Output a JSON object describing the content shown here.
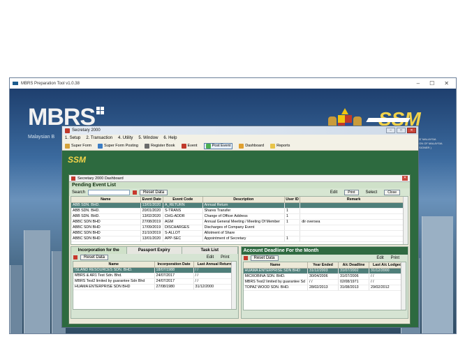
{
  "outer": {
    "title": "MBRS Preparation Tool v1.0.38",
    "logo_main": "MBRS",
    "logo_sub": "Malaysian B",
    "ssm_logo": "SSM",
    "ssm_sub_1": "AT MALAYSIA",
    "ssm_sub_2": "ION OF MALAYSIA",
    "ssm_sub_3": "ISIONER )"
  },
  "secretary": {
    "title": "Secretary 2000",
    "menu": [
      "1. Setup",
      "2. Transaction",
      "4. Utility",
      "5. Window",
      "6. Help"
    ],
    "toolbar": [
      "Super Form",
      "Super Form Posting",
      "Register Book",
      "Event",
      "Post Event",
      "Dashboard",
      "Reports"
    ],
    "badge_text": "SSM"
  },
  "dashboard": {
    "title": "Secretary 2000 Dashboard",
    "pending_title": "Pending Event List",
    "search_label": "Search",
    "search_value": "",
    "reset_label": "Reset Data",
    "edit_label": "Edit",
    "print_label": "Print",
    "select_label": "Select",
    "close_label": "Close",
    "pending_headers": [
      "Name",
      "Event Date",
      "Event Code",
      "Description",
      "User ID",
      "Remark"
    ],
    "pending_rows": [
      [
        "ABB SDN. BHD.",
        "13/01/2020",
        "A_RETURN",
        "Annual Return",
        "",
        ""
      ],
      [
        "ABB SDN. BHD.",
        "20/01/2020",
        "S-TRANS",
        "Shares Transfer",
        "1",
        ""
      ],
      [
        "ABB SDN. BHD.",
        "13/02/2020",
        "CHG-ADDR",
        "Change of Officer Address",
        "1",
        ""
      ],
      [
        "ABBC SDN BHD",
        "27/08/2019",
        "AGM",
        "Annual General Meeting / Meeting Of Member",
        "1",
        "dir oversea"
      ],
      [
        "ABBC SDN BHD",
        "17/09/2019",
        "DISCHARGES",
        "Discharges of Company Event",
        "",
        ""
      ],
      [
        "ABBC SDN BHD",
        "31/10/2019",
        "S-ALLOT",
        "Allotment of Share",
        "",
        ""
      ],
      [
        "ABBC SDN BHD",
        "13/01/2020",
        "APP-SEC",
        "Appointment of Secretary",
        "1",
        ""
      ]
    ],
    "left_tabs": [
      "Incorporation for the Month",
      "Passport Expiry",
      "Task List"
    ],
    "left_headers": [
      "Name",
      "Incorporation Date",
      "Last Annual Return"
    ],
    "left_rows": [
      [
        "ISLAND RESOURCES SDN. BHD.",
        "18/07/1988",
        "/ /"
      ],
      [
        "MBRS & AR1 Test Sdn. Bhd.",
        "24/07/2017",
        "/ /"
      ],
      [
        "MBRS Test2 limited by guarantee Sdn Bhd",
        "24/07/2017",
        "/ /"
      ],
      [
        "HUAMA ENTERPRISE SDN BHD",
        "27/08/1980",
        "31/12/2000"
      ]
    ],
    "right_title": "Account Deadline For the Month",
    "right_headers": [
      "Name",
      "Year Ended",
      "A/c Deadline",
      "Last A/c Lodged"
    ],
    "right_rows": [
      [
        "HUAMA ENTERPRISE SDN BHD",
        "31/12/2003",
        "31/07/2002",
        "31/12/2000"
      ],
      [
        "MICROBINA SDN. BHD.",
        "30/04/2006",
        "31/07/2006",
        "/ /"
      ],
      [
        "MBRS Test2 limited by guarantee Sd",
        "/ /",
        "02/08/1971",
        "/ /"
      ],
      [
        "TOPAZ WOOD SDN. BHD.",
        "28/02/2013",
        "31/08/2013",
        "29/02/2012"
      ]
    ]
  },
  "colors": {
    "green_bg": "#2d6a3f",
    "selected_row": "#4f7f7a",
    "accent_yellow": "#f3d34a"
  }
}
